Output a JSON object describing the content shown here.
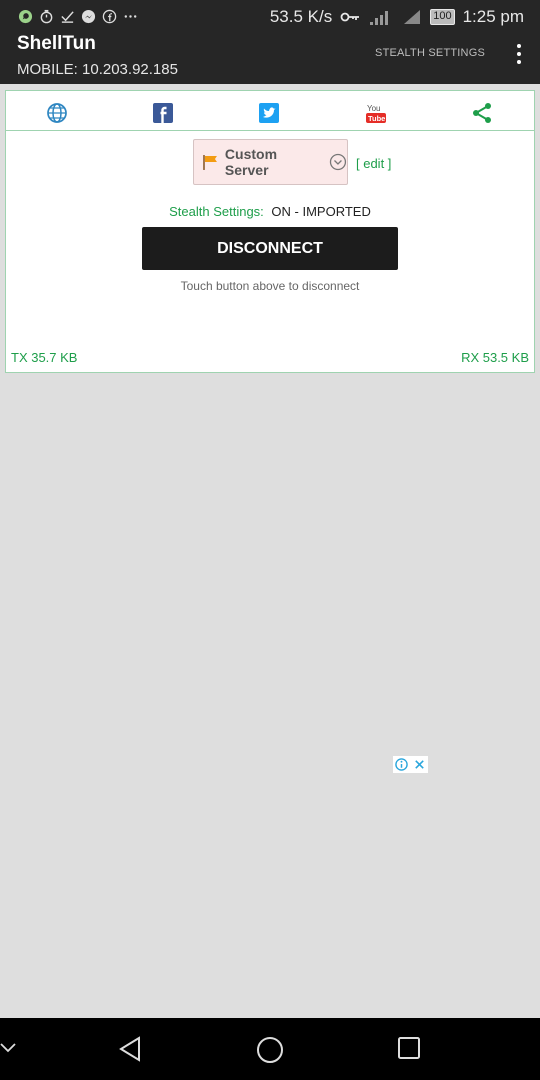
{
  "status_bar": {
    "speed": "53.5 K/s",
    "battery": "100",
    "time": "1:25 pm",
    "icons": [
      "whatsapp-icon",
      "timer-icon",
      "download-done-icon",
      "messenger-icon",
      "facebook-icon",
      "more-notifications-icon",
      "vpn-key-icon",
      "signal-icon",
      "signal-icon",
      "battery-icon"
    ]
  },
  "app_bar": {
    "title": "ShellTun",
    "subtitle": "MOBILE: 10.203.92.185",
    "stealth_settings_label": "STEALTH SETTINGS",
    "overflow_icon": "more-vert-icon"
  },
  "social": {
    "icons": [
      "globe-icon",
      "facebook-icon",
      "twitter-icon",
      "youtube-icon",
      "share-icon"
    ],
    "colors": {
      "accent": "#1e9e4a",
      "facebook": "#3b5998",
      "twitter": "#1da1f2",
      "youtube": "#e52d27",
      "share": "#1e9e4a"
    }
  },
  "server": {
    "label": "Custom Server",
    "edit_label": "[ edit ]",
    "flag_icon": "flag-icon",
    "dropdown_icon": "chevron-down-circle-icon"
  },
  "stealth": {
    "label": "Stealth Settings:",
    "value": "ON - IMPORTED"
  },
  "connection": {
    "button_label": "DISCONNECT",
    "hint": "Touch button above to disconnect"
  },
  "traffic": {
    "tx": "TX 35.7 KB",
    "rx": "RX 53.5 KB"
  },
  "ad": {
    "icons": [
      "adchoices-icon",
      "close-icon"
    ]
  },
  "navigation": {
    "icons": [
      "collapse-icon",
      "back-icon",
      "home-icon",
      "recents-icon"
    ]
  }
}
